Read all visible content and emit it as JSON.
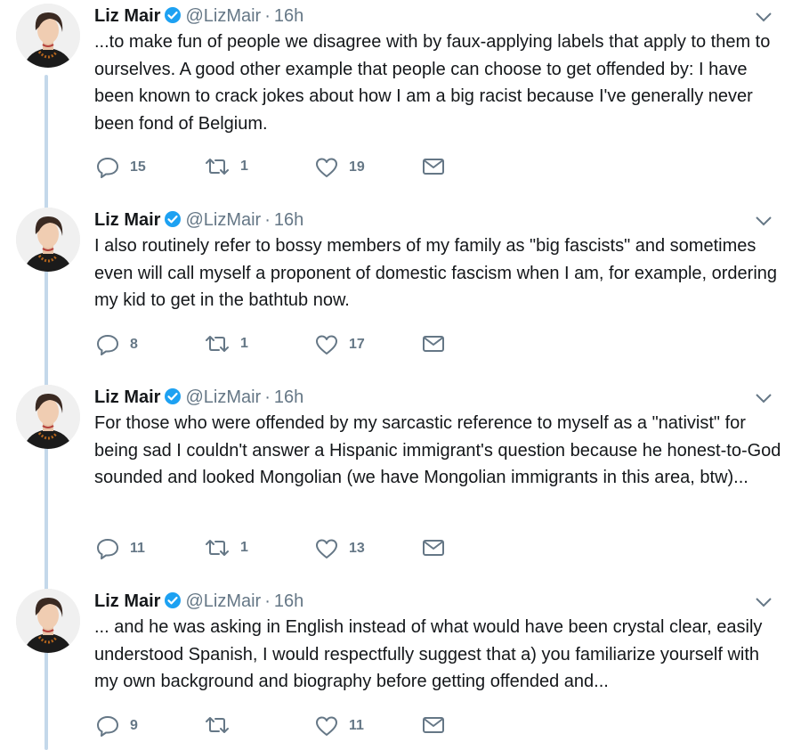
{
  "tweets": [
    {
      "name": "Liz Mair",
      "handle": "@LizMair",
      "separator": "·",
      "time": "16h",
      "text": "...to make fun of people we disagree with by faux-applying labels that apply to them to ourselves. A good other example that people can choose to get offended by: I have been known to crack jokes about how I am a big racist because I've generally never been fond of Belgium.",
      "replies": "15",
      "retweets": "1",
      "likes": "19"
    },
    {
      "name": "Liz Mair",
      "handle": "@LizMair",
      "separator": "·",
      "time": "16h",
      "text": "I also routinely refer to bossy members of my family as \"big fascists\" and sometimes even will call myself a proponent of domestic fascism when I am, for example, ordering my kid to get in the bathtub now.",
      "replies": "8",
      "retweets": "1",
      "likes": "17"
    },
    {
      "name": "Liz Mair",
      "handle": "@LizMair",
      "separator": "·",
      "time": "16h",
      "text": "For those who were offended by my sarcastic reference to myself as a \"nativist\" for being sad I couldn't answer a Hispanic immigrant's question because he honest-to-God sounded and looked Mongolian (we have Mongolian immigrants in this area, btw)...",
      "replies": "11",
      "retweets": "1",
      "likes": "13"
    },
    {
      "name": "Liz Mair",
      "handle": "@LizMair",
      "separator": "·",
      "time": "16h",
      "text": "... and he was asking in English instead of what would have been crystal clear, easily understood Spanish, I would respectfully suggest that a) you familiarize yourself with my own background and biography before getting offended and...",
      "replies": "9",
      "retweets": "",
      "likes": "11"
    }
  ],
  "colors": {
    "verified": "#1da1f2",
    "thread_line": "#c4d8ea",
    "muted": "#657786",
    "text": "#14171a"
  },
  "icons": {
    "verified": "verified-badge-icon",
    "menu": "chevron-down-icon",
    "reply": "reply-icon",
    "retweet": "retweet-icon",
    "like": "heart-icon",
    "message": "envelope-icon"
  }
}
